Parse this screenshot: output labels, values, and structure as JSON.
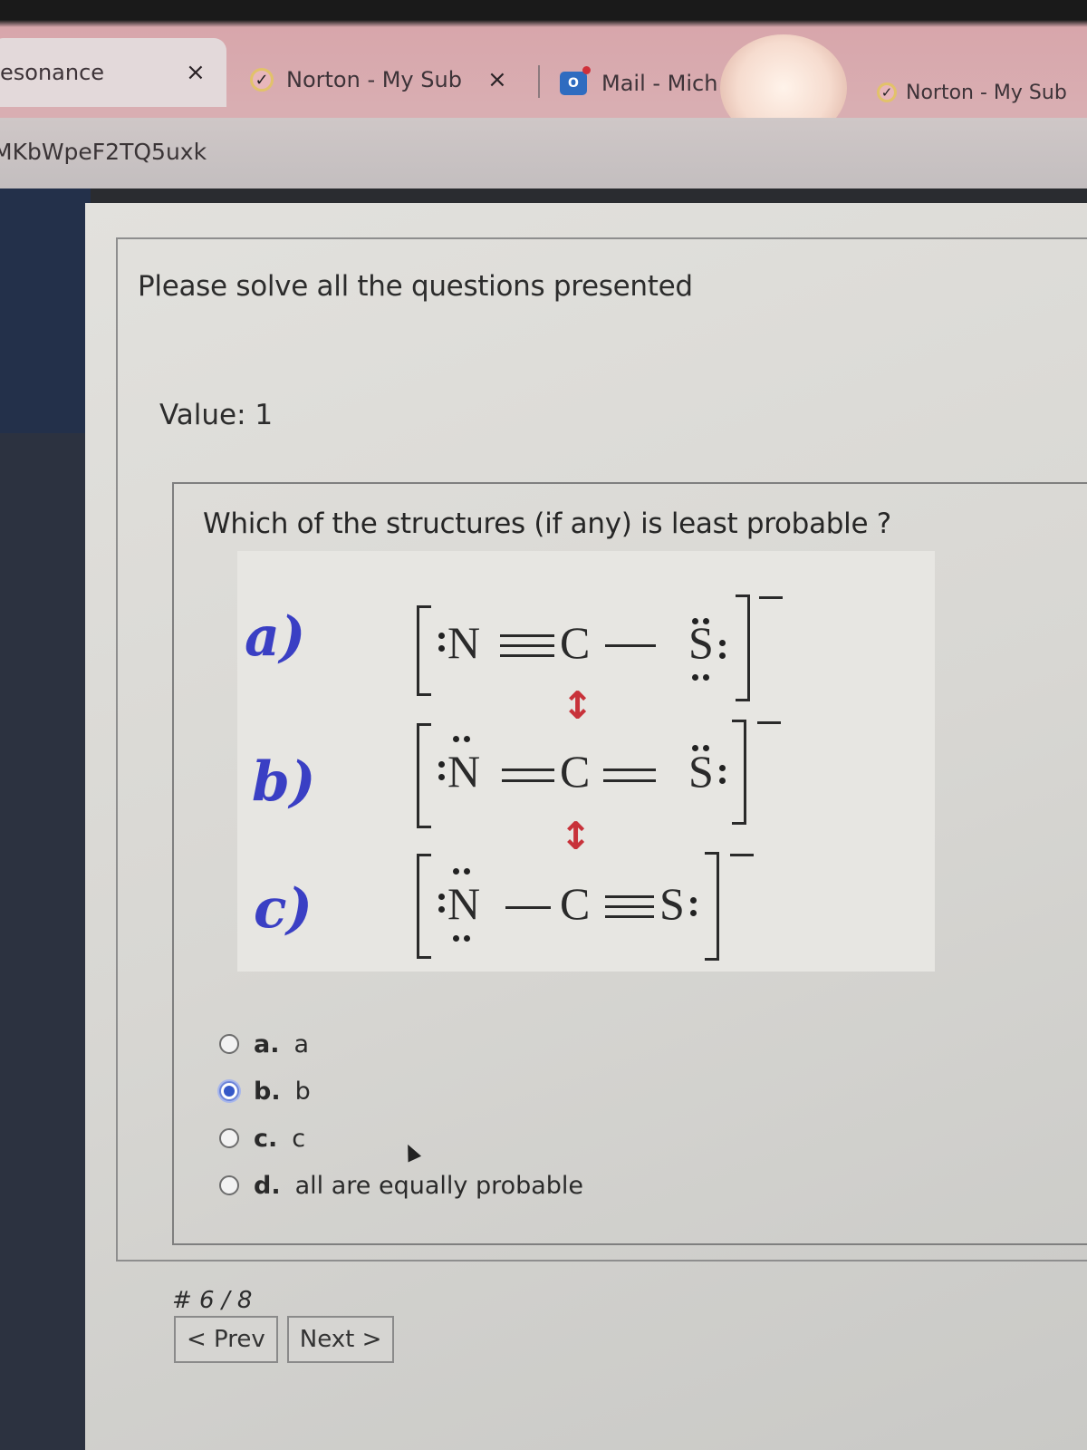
{
  "browser": {
    "tabs": [
      {
        "label": "esonance",
        "active": true,
        "icon": "none",
        "close": "×"
      },
      {
        "label": "Norton - My Sub",
        "active": false,
        "icon": "norton-check-icon",
        "close": "×"
      },
      {
        "label": "Mail - Mich",
        "active": false,
        "icon": "outlook-mail-icon"
      },
      {
        "label": "Norton - My Sub",
        "active": false,
        "icon": "norton-check-icon"
      }
    ],
    "address": "MKbWpeF2TQ5uxk"
  },
  "quiz": {
    "instructions": "Please solve all the questions presented",
    "value_label": "Value: 1",
    "question": "Which of the structures (if any) is least probable ?",
    "figure": {
      "labels": [
        "a)",
        "b)",
        "c)"
      ],
      "structures": [
        {
          "left": "N",
          "left_bond": "≡",
          "center": "C",
          "right_bond": "—",
          "right": "S",
          "charge": "−"
        },
        {
          "left": "N",
          "left_bond": "=",
          "center": "C",
          "right_bond": "=",
          "right": "S",
          "charge": "−"
        },
        {
          "left": "N",
          "left_bond": "—",
          "center": "C",
          "right_bond": "≡",
          "right": "S",
          "charge": "−"
        }
      ],
      "resonance_arrow": "↕",
      "arrow_color": "#c8323a",
      "label_color": "#3a3fc4"
    },
    "options": [
      {
        "letter": "a.",
        "text": "a",
        "selected": false
      },
      {
        "letter": "b.",
        "text": "b",
        "selected": true
      },
      {
        "letter": "c.",
        "text": "c",
        "selected": false
      },
      {
        "letter": "d.",
        "text": "all are equally probable",
        "selected": false
      }
    ],
    "pager": {
      "count": "# 6 / 8",
      "prev_label": "< Prev",
      "next_label": "Next >"
    }
  }
}
